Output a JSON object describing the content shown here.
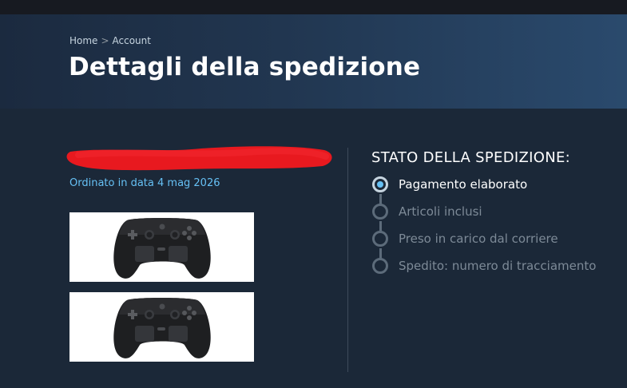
{
  "breadcrumb": {
    "home": "Home",
    "separator": ">",
    "account": "Account"
  },
  "page_title": "Dettagli della spedizione",
  "order": {
    "date_text": "Ordinato in data 4 mag 2026",
    "items": [
      {
        "icon": "gamepad-controller-image"
      },
      {
        "icon": "gamepad-controller-image"
      }
    ]
  },
  "shipping_status": {
    "heading": "STATO DELLA SPEDIZIONE:",
    "steps": [
      {
        "label": "Pagamento elaborato",
        "active": true
      },
      {
        "label": "Articoli inclusi",
        "active": false
      },
      {
        "label": "Preso in carico dal corriere",
        "active": false
      },
      {
        "label": "Spedito: numero di tracciamento",
        "active": false
      }
    ]
  },
  "colors": {
    "background": "#1b2838",
    "accent": "#66c0f4",
    "redaction": "#e8191f"
  }
}
